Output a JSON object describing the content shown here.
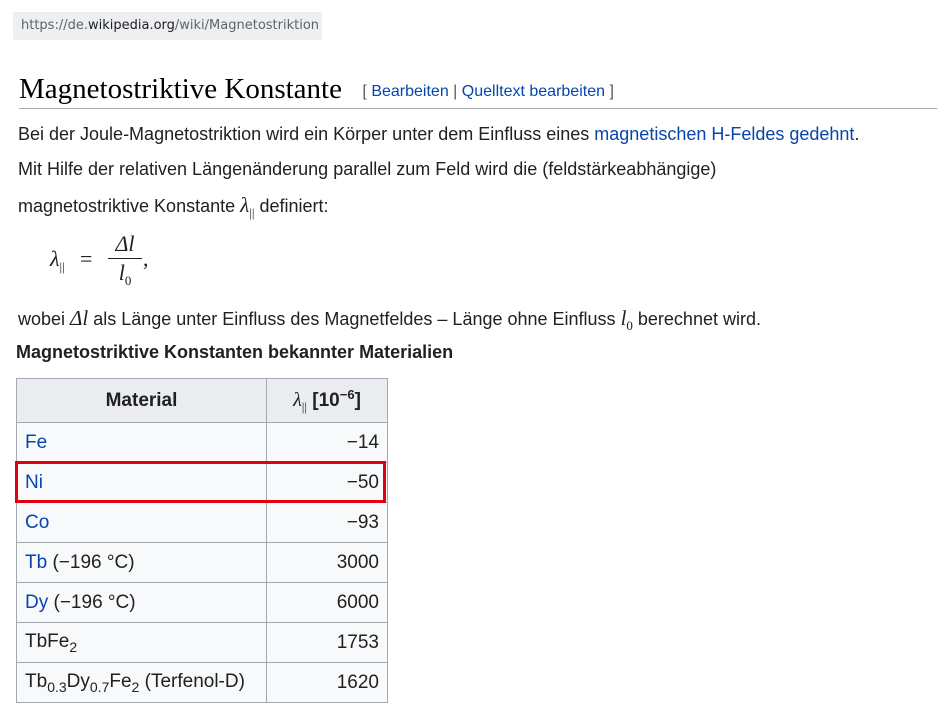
{
  "browser": {
    "url_prefix": "https://de.",
    "url_domain": "wikipedia.org",
    "url_path": "/wiki/Magnetostriktion"
  },
  "section": {
    "title": "Magnetostriktive Konstante",
    "edit_open": "[",
    "edit_link": "Bearbeiten",
    "edit_sep": "|",
    "source_link": "Quelltext bearbeiten",
    "edit_close": "]"
  },
  "paragraph": {
    "line1_text": "Bei der Joule-Magnetostriktion wird ein Körper unter dem Einfluss eines ",
    "line1_link": "magnetischen H-Feldes gedehnt",
    "line1_end": ".",
    "line2": "Mit Hilfe der relativen Längenänderung  parallel zum Feld wird die (feldstärkeabhängige)",
    "line3_start": "magnetostriktive Konstante ",
    "line3_end": " definiert:",
    "line4_a": "wobei ",
    "line4_b": " als Länge unter Einfluss des Magnetfeldes – Länge ohne Einfluss ",
    "line4_c": " berechnet wird."
  },
  "math": {
    "lambda": "λ",
    "parallel": "||",
    "equals": "=",
    "delta_l": "Δl",
    "l": "l",
    "zero": "0",
    "comma": ","
  },
  "table": {
    "caption": "Magnetostriktive Konstanten bekannter Materialien",
    "header_material": "Material",
    "header_unit_open": "[10",
    "header_unit_exp": "−6",
    "header_unit_close": "]",
    "rows": [
      {
        "link": "Fe",
        "extra": "",
        "value": "−14"
      },
      {
        "link": "Ni",
        "extra": "",
        "value": "−50"
      },
      {
        "link": "Co",
        "extra": "",
        "value": "−93"
      },
      {
        "link": "Tb",
        "extra": " (−196 °C)",
        "value": "3000"
      },
      {
        "link": "Dy",
        "extra": " (−196 °C)",
        "value": "6000"
      }
    ],
    "row_tbfe2": {
      "base": "TbFe",
      "sub": "2",
      "value": "1753"
    },
    "row_terfenol": {
      "a": "Tb",
      "a_sub": "0.3",
      "b": "Dy",
      "b_sub": "0.7",
      "c": "Fe",
      "c_sub": "2",
      "d": " (Terfenol-D)",
      "value": "1620"
    }
  },
  "colors": {
    "link": "#0645ad",
    "highlight": "#e0000f",
    "header_bg": "#eaecf0"
  }
}
